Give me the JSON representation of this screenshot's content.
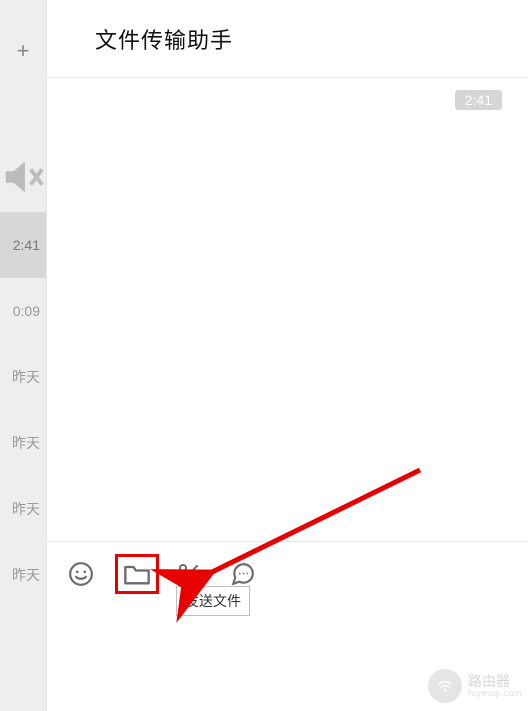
{
  "sidebar": {
    "add_label": "+",
    "items": [
      {
        "time": "2:41",
        "selected": true
      },
      {
        "time": "0:09",
        "selected": false
      },
      {
        "time": "昨天",
        "selected": false
      },
      {
        "time": "昨天",
        "selected": false
      },
      {
        "time": "昨天",
        "selected": false
      },
      {
        "time": "昨天",
        "selected": false
      }
    ]
  },
  "header": {
    "title": "文件传输助手"
  },
  "chat": {
    "last_time": "2:41"
  },
  "toolbar": {
    "emoji_name": "emoji-icon",
    "file_name": "folder-icon",
    "screenshot_name": "scissors-icon",
    "more_name": "more-icon",
    "file_tooltip": "发送文件"
  },
  "watermark": {
    "brand": "路由器",
    "domain": "fuyouqi.com"
  },
  "annotation": {
    "highlight_color": "#e60000"
  }
}
